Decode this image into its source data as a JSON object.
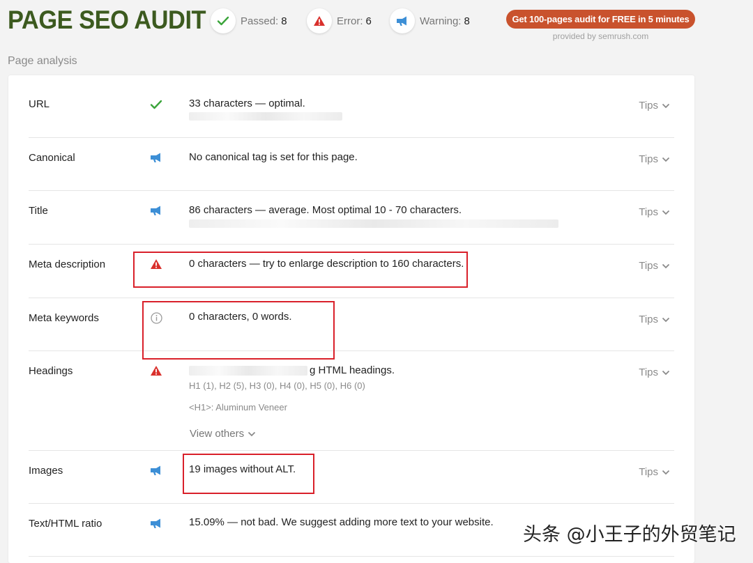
{
  "header": {
    "title": "PAGE SEO AUDIT",
    "stats": {
      "passed": {
        "label": "Passed:",
        "count": "8",
        "icon": "check-icon",
        "color": "#3aa43a"
      },
      "error": {
        "label": "Error:",
        "count": "6",
        "icon": "warning-triangle-icon",
        "color": "#d9302c"
      },
      "warning": {
        "label": "Warning:",
        "count": "8",
        "icon": "megaphone-icon",
        "color": "#3d8fd6"
      }
    },
    "cta_label": "Get 100-pages audit for FREE in 5 minutes",
    "provided_by": "provided by  semrush.com"
  },
  "section_label": "Page analysis",
  "rows": [
    {
      "label": "URL",
      "status": "passed",
      "icon": "check-icon",
      "text": "33 characters — optimal.",
      "tips": "Tips"
    },
    {
      "label": "Canonical",
      "status": "warning",
      "icon": "megaphone-icon",
      "text": "No canonical tag is set for this page.",
      "tips": "Tips"
    },
    {
      "label": "Title",
      "status": "warning",
      "icon": "megaphone-icon",
      "text": "86 characters — average. Most optimal 10 - 70 characters.",
      "tips": "Tips"
    },
    {
      "label": "Meta description",
      "status": "error",
      "icon": "warning-triangle-icon",
      "text": "0 characters — try to enlarge description to 160 characters.",
      "tips": "Tips"
    },
    {
      "label": "Meta keywords",
      "status": "info",
      "icon": "info-icon",
      "text": "0 characters, 0 words.",
      "tips": "Tips"
    },
    {
      "label": "Headings",
      "status": "error",
      "icon": "warning-triangle-icon",
      "text": "g HTML headings.",
      "subtext": "H1 (1), H2 (5), H3 (0), H4 (0), H5 (0), H6 (0)",
      "h1_text": "<H1>: Aluminum Veneer",
      "view_others": "View others",
      "tips": "Tips"
    },
    {
      "label": "Images",
      "status": "warning",
      "icon": "megaphone-icon",
      "text": "19 images without ALT.",
      "tips": "Tips"
    },
    {
      "label": "Text/HTML ratio",
      "status": "warning",
      "icon": "megaphone-icon",
      "text": "15.09% — not bad. We suggest adding more text to your website."
    }
  ],
  "watermark": "头条 @小王子的外贸笔记",
  "colors": {
    "title_green": "#3c5a1f",
    "cta_orange": "#c9522d",
    "highlight_red": "#d9202a"
  }
}
